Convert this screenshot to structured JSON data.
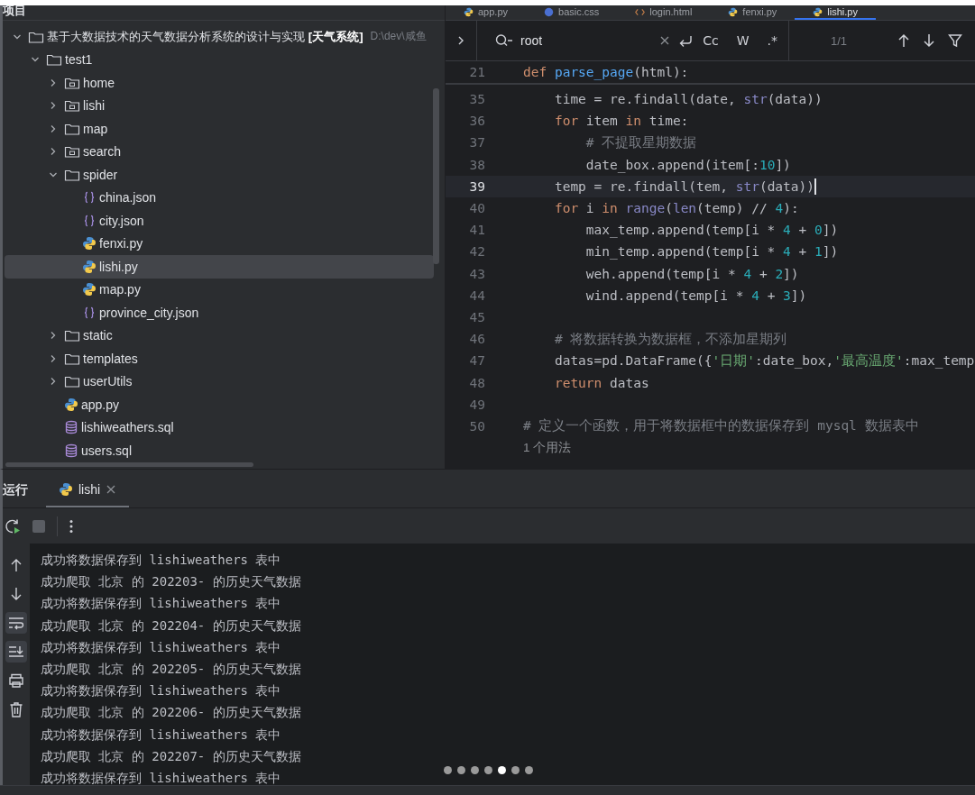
{
  "project": {
    "title": "项目",
    "tree": [
      {
        "name": "基于大数据技术的天气数据分析系统的设计与实现 **[天气系统]**",
        "path": "D:\\dev\\咸鱼",
        "kind": "folder",
        "expanded": true,
        "selected": false,
        "children": [
          {
            "name": "test1",
            "kind": "folder",
            "expanded": true,
            "selected": false,
            "children": [
              {
                "name": "home",
                "kind": "package",
                "expanded": false,
                "selected": false
              },
              {
                "name": "lishi",
                "kind": "package",
                "expanded": false,
                "selected": false
              },
              {
                "name": "map",
                "kind": "folder",
                "expanded": false,
                "selected": false
              },
              {
                "name": "search",
                "kind": "package",
                "expanded": false,
                "selected": false
              },
              {
                "name": "spider",
                "kind": "folder",
                "expanded": true,
                "selected": false,
                "children": [
                  {
                    "name": "china.json",
                    "kind": "json",
                    "selected": false
                  },
                  {
                    "name": "city.json",
                    "kind": "json",
                    "selected": false
                  },
                  {
                    "name": "fenxi.py",
                    "kind": "python",
                    "selected": false
                  },
                  {
                    "name": "lishi.py",
                    "kind": "python",
                    "selected": true
                  },
                  {
                    "name": "map.py",
                    "kind": "python",
                    "selected": false
                  },
                  {
                    "name": "province_city.json",
                    "kind": "json",
                    "selected": false
                  }
                ]
              },
              {
                "name": "static",
                "kind": "folder",
                "expanded": false,
                "selected": false
              },
              {
                "name": "templates",
                "kind": "folder",
                "expanded": false,
                "selected": false
              },
              {
                "name": "userUtils",
                "kind": "folder",
                "expanded": false,
                "selected": false
              },
              {
                "name": "app.py",
                "kind": "python",
                "selected": false
              },
              {
                "name": "lishiweathers.sql",
                "kind": "sql",
                "selected": false
              },
              {
                "name": "users.sql",
                "kind": "sql",
                "selected": false
              }
            ]
          }
        ]
      }
    ]
  },
  "editor": {
    "tabs": [
      {
        "label": "app.py",
        "kind": "python",
        "selected": false
      },
      {
        "label": "basic.css",
        "kind": "css",
        "selected": false
      },
      {
        "label": "login.html",
        "kind": "html",
        "selected": false
      },
      {
        "label": "fenxi.py",
        "kind": "python",
        "selected": false
      },
      {
        "label": "lishi.py",
        "kind": "python",
        "selected": true
      }
    ],
    "search": {
      "value": "root",
      "options": [
        "Cc",
        "W",
        ".*"
      ],
      "count": "1/1"
    },
    "sticky_line": {
      "number": "21",
      "tokens": [
        {
          "kind": "keyword",
          "text": "def "
        },
        {
          "kind": "function",
          "text": "parse_page"
        },
        {
          "kind": "plain",
          "text": "(html):"
        }
      ]
    },
    "lines": [
      {
        "number": "35",
        "current": false,
        "tokens": [
          {
            "kind": "plain",
            "text": "    time = re.findall(date, "
          },
          {
            "kind": "builtin",
            "text": "str"
          },
          {
            "kind": "plain",
            "text": "(data))"
          }
        ]
      },
      {
        "number": "36",
        "current": false,
        "tokens": [
          {
            "kind": "keyword",
            "text": "    for"
          },
          {
            "kind": "plain",
            "text": " item "
          },
          {
            "kind": "keyword",
            "text": "in"
          },
          {
            "kind": "plain",
            "text": " time:"
          }
        ]
      },
      {
        "number": "37",
        "current": false,
        "tokens": [
          {
            "kind": "comment",
            "text": "        # 不提取星期数据"
          }
        ]
      },
      {
        "number": "38",
        "current": false,
        "tokens": [
          {
            "kind": "plain",
            "text": "        date_box.append(item[:"
          },
          {
            "kind": "number",
            "text": "10"
          },
          {
            "kind": "plain",
            "text": "])"
          }
        ]
      },
      {
        "number": "39",
        "current": true,
        "tokens": [
          {
            "kind": "plain",
            "text": "    temp = re.findall(tem, "
          },
          {
            "kind": "builtin",
            "text": "str"
          },
          {
            "kind": "plain",
            "text": "(data))"
          }
        ]
      },
      {
        "number": "40",
        "current": false,
        "tokens": [
          {
            "kind": "keyword",
            "text": "    for"
          },
          {
            "kind": "plain",
            "text": " i "
          },
          {
            "kind": "keyword",
            "text": "in"
          },
          {
            "kind": "builtin",
            "text": " range"
          },
          {
            "kind": "plain",
            "text": "("
          },
          {
            "kind": "builtin",
            "text": "len"
          },
          {
            "kind": "plain",
            "text": "(temp) // "
          },
          {
            "kind": "number",
            "text": "4"
          },
          {
            "kind": "plain",
            "text": "):"
          }
        ]
      },
      {
        "number": "41",
        "current": false,
        "tokens": [
          {
            "kind": "plain",
            "text": "        max_temp.append(temp[i * "
          },
          {
            "kind": "number",
            "text": "4"
          },
          {
            "kind": "plain",
            "text": " + "
          },
          {
            "kind": "number",
            "text": "0"
          },
          {
            "kind": "plain",
            "text": "])"
          }
        ]
      },
      {
        "number": "42",
        "current": false,
        "tokens": [
          {
            "kind": "plain",
            "text": "        min_temp.append(temp[i * "
          },
          {
            "kind": "number",
            "text": "4"
          },
          {
            "kind": "plain",
            "text": " + "
          },
          {
            "kind": "number",
            "text": "1"
          },
          {
            "kind": "plain",
            "text": "])"
          }
        ]
      },
      {
        "number": "43",
        "current": false,
        "tokens": [
          {
            "kind": "plain",
            "text": "        weh.append(temp[i * "
          },
          {
            "kind": "number",
            "text": "4"
          },
          {
            "kind": "plain",
            "text": " + "
          },
          {
            "kind": "number",
            "text": "2"
          },
          {
            "kind": "plain",
            "text": "])"
          }
        ]
      },
      {
        "number": "44",
        "current": false,
        "tokens": [
          {
            "kind": "plain",
            "text": "        wind.append(temp[i * "
          },
          {
            "kind": "number",
            "text": "4"
          },
          {
            "kind": "plain",
            "text": " + "
          },
          {
            "kind": "number",
            "text": "3"
          },
          {
            "kind": "plain",
            "text": "])"
          }
        ]
      },
      {
        "number": "45",
        "current": false
      },
      {
        "number": "46",
        "current": false,
        "tokens": [
          {
            "kind": "comment",
            "text": "    # 将数据转换为数据框，不添加星期列"
          }
        ]
      },
      {
        "number": "47",
        "current": false,
        "tokens": [
          {
            "kind": "plain",
            "text": "    datas=pd.DataFrame({"
          },
          {
            "kind": "string",
            "text": "'日期'"
          },
          {
            "kind": "plain",
            "text": ":date_box,"
          },
          {
            "kind": "string",
            "text": "'最高温度'"
          },
          {
            "kind": "plain",
            "text": ":max_temp"
          }
        ]
      },
      {
        "number": "48",
        "current": false,
        "tokens": [
          {
            "kind": "keyword",
            "text": "    return"
          },
          {
            "kind": "plain",
            "text": " datas"
          }
        ]
      },
      {
        "number": "49",
        "current": false
      },
      {
        "number": "50",
        "current": false,
        "tokens": [
          {
            "kind": "comment",
            "text": "# 定义一个函数，用于将数据框中的数据保存到 mysql 数据表中"
          }
        ]
      }
    ],
    "usage_hint": "1 个用法"
  },
  "run": {
    "title": "运行",
    "tabs": [
      {
        "label": "lishi",
        "selected": true
      }
    ],
    "tools": [
      {
        "kind": "up",
        "active": false
      },
      {
        "kind": "down",
        "active": false
      },
      {
        "kind": "wrap",
        "active": true
      },
      {
        "kind": "scroll-end",
        "active": true
      },
      {
        "kind": "print",
        "active": false
      },
      {
        "kind": "trash",
        "active": false
      }
    ],
    "output": [
      "成功将数据保存到 lishiweathers 表中",
      "成功爬取 北京 的 202203- 的历史天气数据",
      "成功将数据保存到 lishiweathers 表中",
      "成功爬取 北京 的 202204- 的历史天气数据",
      "成功将数据保存到 lishiweathers 表中",
      "成功爬取 北京 的 202205- 的历史天气数据",
      "成功将数据保存到 lishiweathers 表中",
      "成功爬取 北京 的 202206- 的历史天气数据",
      "成功将数据保存到 lishiweathers 表中",
      "成功爬取 北京 的 202207- 的历史天气数据",
      "成功将数据保存到 lishiweathers 表中"
    ]
  },
  "carousel": [
    {
      "selected": false
    },
    {
      "selected": false
    },
    {
      "selected": false
    },
    {
      "selected": false
    },
    {
      "selected": true
    },
    {
      "selected": false
    },
    {
      "selected": false
    }
  ]
}
